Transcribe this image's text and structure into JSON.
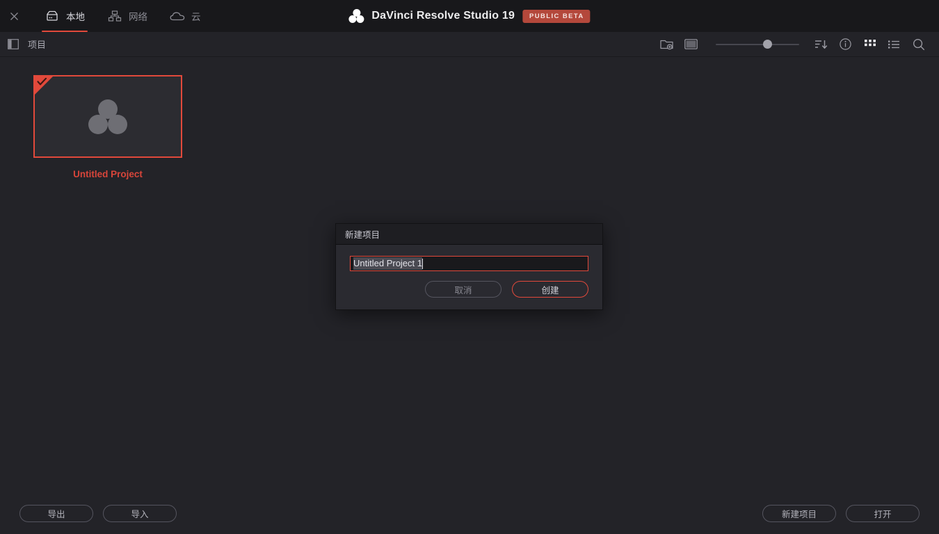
{
  "window": {
    "close_icon": "close-icon"
  },
  "tabs": [
    {
      "id": "local",
      "label": "本地",
      "icon": "hard-drive-icon",
      "active": true
    },
    {
      "id": "network",
      "label": "网络",
      "icon": "network-icon",
      "active": false
    },
    {
      "id": "cloud",
      "label": "云",
      "icon": "cloud-icon",
      "active": false
    }
  ],
  "header": {
    "app_title": "DaVinci Resolve Studio 19",
    "badge": "PUBLIC BETA",
    "logo_icon": "davinci-resolve-logo-icon"
  },
  "toolbar": {
    "panel_toggle_icon": "panel-toggle-icon",
    "breadcrumb": "项目",
    "new_folder_icon": "new-folder-icon",
    "new_window_icon": "new-window-icon",
    "zoom_slider_value": "62",
    "sort_icon": "sort-descending-icon",
    "info_icon": "info-icon",
    "grid_view_icon": "grid-view-icon",
    "list_view_icon": "list-view-icon",
    "search_icon": "search-icon"
  },
  "projects": [
    {
      "name": "Untitled Project",
      "selected": true,
      "badge_icon": "check-icon",
      "thumb_icon": "davinci-resolve-logo-icon"
    }
  ],
  "bottom_bar": {
    "export_label": "导出",
    "import_label": "导入",
    "new_project_label": "新建项目",
    "open_label": "打开"
  },
  "dialog": {
    "title": "新建项目",
    "input_value": "Untitled Project 1",
    "input_placeholder": "Untitled Project 1",
    "cancel_label": "取消",
    "create_label": "创建"
  },
  "colors": {
    "accent_red": "#e2493b",
    "project_name_red": "#d8453a",
    "badge_bg": "#b4483b",
    "app_bg": "#232328",
    "topbar_bg": "#18181b",
    "dialog_bg": "#2a2a30"
  }
}
